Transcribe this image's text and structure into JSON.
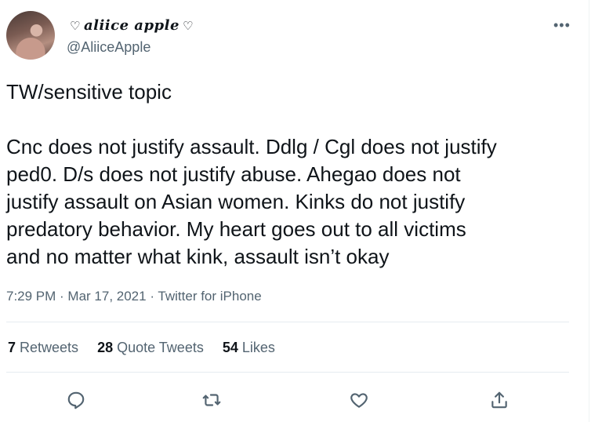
{
  "header": {
    "display_name": "aliice apple",
    "name_decoration_left": "♡",
    "name_decoration_right": "♡",
    "handle": "@AliiceApple",
    "more_icon": "more-horizontal-icon"
  },
  "tweet": {
    "text": "TW/sensitive topic\n\nCnc does not justify assault. Ddlg / Cgl does not justify\nped0. D/s does not justify abuse. Ahegao does not\njustify assault on Asian women. Kinks do not justify\npredatory behavior. My heart goes out to all victims\nand no matter what kink, assault isn’t okay",
    "time": "7:29 PM",
    "separator": " · ",
    "date": "Mar 17, 2021",
    "client": "Twitter for iPhone"
  },
  "stats": {
    "retweets_count": "7",
    "retweets_label": " Retweets",
    "quote_count": "28",
    "quote_label": " Quote Tweets",
    "likes_count": "54",
    "likes_label": " Likes"
  },
  "actions": [
    {
      "icon": "reply-icon"
    },
    {
      "icon": "retweet-icon"
    },
    {
      "icon": "like-icon"
    },
    {
      "icon": "share-icon"
    }
  ],
  "colors": {
    "text": "#0f1419",
    "secondary": "#536471",
    "divider": "#e6ecf0",
    "background": "#ffffff"
  }
}
